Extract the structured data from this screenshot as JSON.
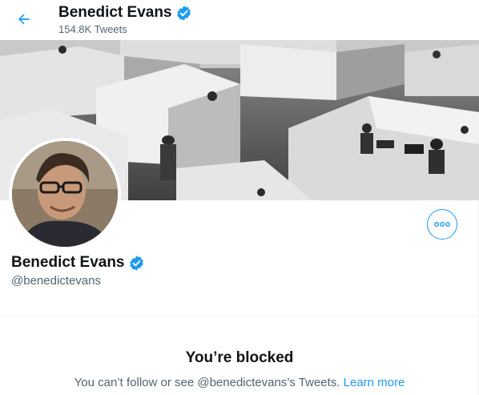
{
  "header": {
    "name": "Benedict Evans",
    "tweet_count": "154.8K Tweets"
  },
  "profile": {
    "name": "Benedict Evans",
    "handle": "@benedictevans",
    "verified": true
  },
  "blocked": {
    "title": "You’re blocked",
    "message": "You can’t follow or see @benedictevans’s Tweets.",
    "learn_more": "Learn more"
  },
  "colors": {
    "accent": "#1d9bf0",
    "text_primary": "#0f1419",
    "text_secondary": "#536471"
  },
  "icons": {
    "back": "arrow-left-icon",
    "verified": "verified-badge-icon",
    "more": "more-dots-icon"
  }
}
